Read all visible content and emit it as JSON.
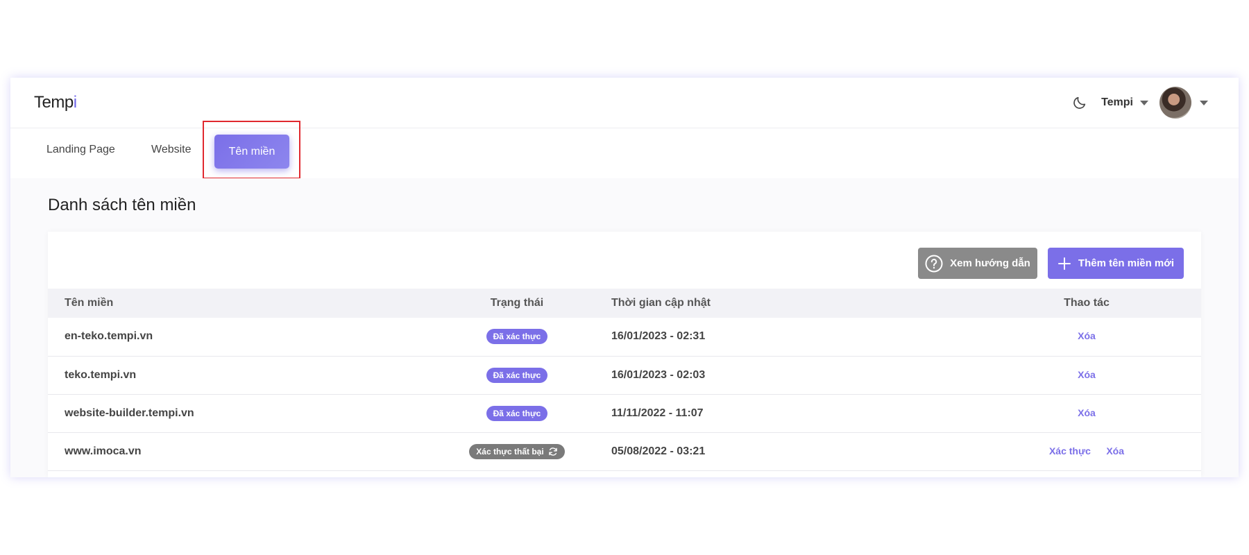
{
  "header": {
    "logo_main": "Temp",
    "logo_accent": "i",
    "user_name": "Tempi"
  },
  "tabs": [
    {
      "label": "Landing Page"
    },
    {
      "label": "Website"
    },
    {
      "label": "Tên miền",
      "active": true
    }
  ],
  "page_title": "Danh sách tên miền",
  "toolbar": {
    "guide_label": "Xem hướng dẫn",
    "add_label": "Thêm tên miền mới"
  },
  "table": {
    "columns": [
      "Tên miền",
      "Trạng thái",
      "Thời gian cập nhật",
      "Thao tác"
    ],
    "rows": [
      {
        "domain": "en-teko.tempi.vn",
        "status": "Đã xác thực",
        "updated": "16/01/2023 - 02:31",
        "actions": [
          "Xóa"
        ]
      },
      {
        "domain": "teko.tempi.vn",
        "status": "Đã xác thực",
        "updated": "16/01/2023 - 02:03",
        "actions": [
          "Xóa"
        ]
      },
      {
        "domain": "website-builder.tempi.vn",
        "status": "Đã xác thực",
        "updated": "11/11/2022 - 11:07",
        "actions": [
          "Xóa"
        ]
      },
      {
        "domain": "www.imoca.vn",
        "status": "Xác thực thất bại",
        "updated": "05/08/2022 - 03:21",
        "actions": [
          "Xác thực",
          "Xóa"
        ]
      }
    ]
  },
  "colors": {
    "accent": "#7b6fe8",
    "failed_badge": "#7a7a7a",
    "highlight": "#e0282e"
  },
  "icons": {
    "theme_toggle": "moon-icon",
    "guide": "question-circle-icon",
    "add": "plus-icon",
    "retry": "refresh-icon"
  }
}
